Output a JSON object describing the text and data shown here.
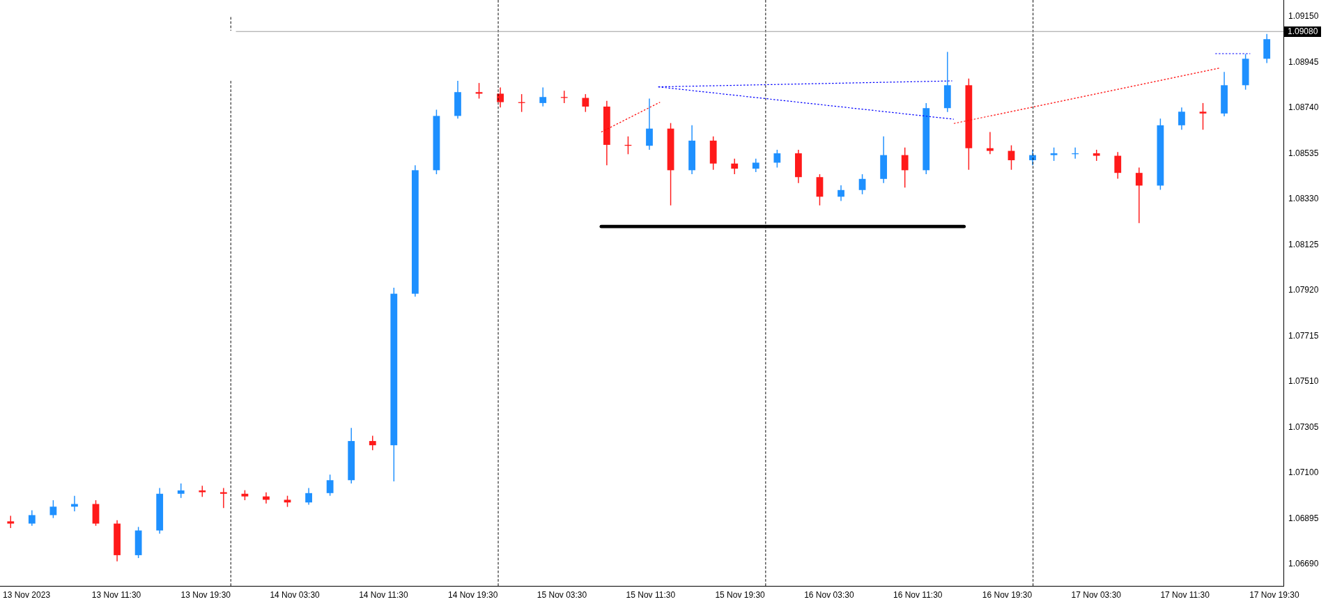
{
  "chart_data": {
    "type": "candlestick",
    "ylim": [
      1.0659,
      1.09223
    ],
    "yticks": [
      {
        "value": 1.0915,
        "label": "1.09150"
      },
      {
        "value": 1.08945,
        "label": "1.08945"
      },
      {
        "value": 1.0874,
        "label": "1.08740"
      },
      {
        "value": 1.08535,
        "label": "1.08535"
      },
      {
        "value": 1.0833,
        "label": "1.08330"
      },
      {
        "value": 1.08125,
        "label": "1.08125"
      },
      {
        "value": 1.0792,
        "label": "1.07920"
      },
      {
        "value": 1.07715,
        "label": "1.07715"
      },
      {
        "value": 1.0751,
        "label": "1.07510"
      },
      {
        "value": 1.07305,
        "label": "1.07305"
      },
      {
        "value": 1.071,
        "label": "1.07100"
      },
      {
        "value": 1.06895,
        "label": "1.06895"
      },
      {
        "value": 1.0669,
        "label": "1.06690"
      }
    ],
    "categories": [
      null,
      null,
      null,
      null,
      null,
      null,
      null,
      null,
      null,
      null,
      null,
      null,
      null,
      null,
      null,
      null,
      null,
      null,
      null,
      null,
      null,
      null,
      null,
      null,
      null,
      null,
      null,
      null,
      null,
      null,
      null,
      null,
      null,
      null,
      null,
      null,
      null,
      null,
      null,
      null,
      null,
      null,
      null,
      null,
      null,
      null,
      null,
      null,
      null,
      null,
      null,
      null,
      null,
      null,
      null,
      null,
      null,
      null,
      null,
      null
    ],
    "ohlc": [
      [
        1.0688,
        1.06905,
        1.0685,
        1.0687
      ],
      [
        1.0687,
        1.0693,
        1.0686,
        1.06908
      ],
      [
        1.06908,
        1.06975,
        1.06895,
        1.06946
      ],
      [
        1.06946,
        1.06995,
        1.06925,
        1.06958
      ],
      [
        1.06958,
        1.06975,
        1.0686,
        1.0687
      ],
      [
        1.0687,
        1.06885,
        1.067,
        1.06728
      ],
      [
        1.06728,
        1.06855,
        1.06715,
        1.06839
      ],
      [
        1.06839,
        1.0703,
        1.06825,
        1.07004
      ],
      [
        1.07004,
        1.0705,
        1.06985,
        1.07019
      ],
      [
        1.07019,
        1.0704,
        1.0699,
        1.07011
      ],
      [
        1.07011,
        1.0703,
        1.0694,
        1.07004
      ],
      [
        1.07004,
        1.0702,
        1.06975,
        1.06992
      ],
      [
        1.06992,
        1.0701,
        1.0696,
        1.06977
      ],
      [
        1.06977,
        1.06995,
        1.06945,
        1.06965
      ],
      [
        1.06965,
        1.0703,
        1.06955,
        1.07007
      ],
      [
        1.07007,
        1.0709,
        1.06995,
        1.07065
      ],
      [
        1.07065,
        1.073,
        1.0705,
        1.07241
      ],
      [
        1.07241,
        1.07265,
        1.072,
        1.07222
      ],
      [
        1.07222,
        1.0793,
        1.0706,
        1.07903
      ],
      [
        1.07903,
        1.0848,
        1.0789,
        1.08458
      ],
      [
        1.08458,
        1.0873,
        1.0844,
        1.08702
      ],
      [
        1.08702,
        1.0886,
        1.0869,
        1.08809
      ],
      [
        1.08809,
        1.0885,
        1.0878,
        1.08802
      ],
      [
        1.08802,
        1.0883,
        1.0874,
        1.08764
      ],
      [
        1.08764,
        1.088,
        1.0872,
        1.0876
      ],
      [
        1.0876,
        1.0883,
        1.08745,
        1.08787
      ],
      [
        1.08787,
        1.08815,
        1.0876,
        1.08783
      ],
      [
        1.08783,
        1.088,
        1.0872,
        1.08744
      ],
      [
        1.08744,
        1.0877,
        1.0848,
        1.08572
      ],
      [
        1.08572,
        1.0861,
        1.0853,
        1.08568
      ],
      [
        1.08568,
        1.0878,
        1.0855,
        1.08645
      ],
      [
        1.08645,
        1.0867,
        1.083,
        1.08458
      ],
      [
        1.08458,
        1.0866,
        1.0844,
        1.08591
      ],
      [
        1.08591,
        1.0861,
        1.0846,
        1.08488
      ],
      [
        1.08488,
        1.0851,
        1.0844,
        1.08465
      ],
      [
        1.08465,
        1.0851,
        1.0845,
        1.08492
      ],
      [
        1.08492,
        1.0855,
        1.0847,
        1.08534
      ],
      [
        1.08534,
        1.0855,
        1.084,
        1.08427
      ],
      [
        1.08427,
        1.0844,
        1.083,
        1.08339
      ],
      [
        1.08339,
        1.0839,
        1.0832,
        1.08369
      ],
      [
        1.08369,
        1.0844,
        1.0835,
        1.08419
      ],
      [
        1.08419,
        1.0861,
        1.084,
        1.08526
      ],
      [
        1.08526,
        1.0856,
        1.0838,
        1.08458
      ],
      [
        1.08458,
        1.0876,
        1.0844,
        1.08737
      ],
      [
        1.08737,
        1.0899,
        1.0872,
        1.0884
      ],
      [
        1.0884,
        1.0887,
        1.0846,
        1.08557
      ],
      [
        1.08557,
        1.0863,
        1.0853,
        1.08545
      ],
      [
        1.08545,
        1.0857,
        1.0846,
        1.08503
      ],
      [
        1.08503,
        1.0855,
        1.0848,
        1.08526
      ],
      [
        1.08526,
        1.0856,
        1.085,
        1.08534
      ],
      [
        1.08534,
        1.0856,
        1.0851,
        1.08534
      ],
      [
        1.08534,
        1.0855,
        1.085,
        1.08523
      ],
      [
        1.08523,
        1.0854,
        1.0842,
        1.08446
      ],
      [
        1.08446,
        1.0847,
        1.0822,
        1.08389
      ],
      [
        1.08389,
        1.0869,
        1.0837,
        1.0866
      ],
      [
        1.0866,
        1.0874,
        1.0864,
        1.08721
      ],
      [
        1.08721,
        1.0876,
        1.0864,
        1.08713
      ],
      [
        1.08713,
        1.089,
        1.087,
        1.0884
      ],
      [
        1.0884,
        1.0898,
        1.0882,
        1.08959
      ],
      [
        1.08959,
        1.0907,
        1.0894,
        1.09047
      ]
    ]
  },
  "price_axis": {
    "current_price": "1.09080"
  },
  "time_axis": {
    "labels": [
      "13 Nov 2023",
      "13 Nov 11:30",
      "13 Nov 19:30",
      "14 Nov 03:30",
      "14 Nov 11:30",
      "14 Nov 19:30",
      "15 Nov 03:30",
      "15 Nov 11:30",
      "15 Nov 19:30",
      "16 Nov 03:30",
      "16 Nov 11:30",
      "16 Nov 19:30",
      "17 Nov 03:30",
      "17 Nov 11:30",
      "17 Nov 19:30"
    ]
  }
}
